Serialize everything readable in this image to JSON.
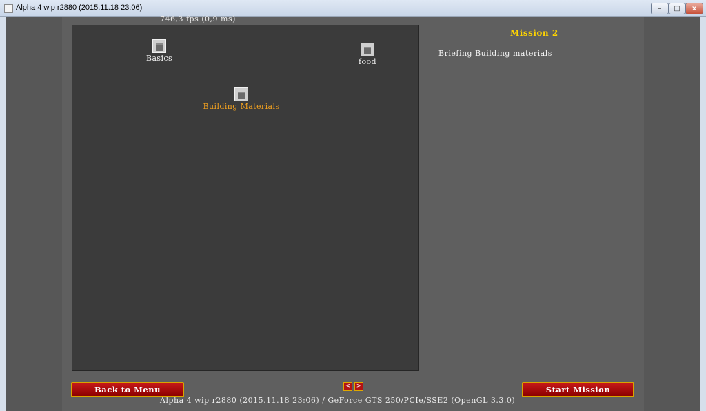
{
  "window": {
    "title": "Alpha 4 wip r2880 (2015.11.18 23:06)",
    "minimize_glyph": "–",
    "maximize_glyph": "□",
    "close_glyph": "x"
  },
  "fps_counter": "746,3 fps (0,9 ms)",
  "campaign_map": {
    "nodes": [
      {
        "label": "Basics",
        "icon": "castle-icon"
      },
      {
        "label": "food",
        "icon": "castle-icon"
      },
      {
        "label": "Building Materials",
        "icon": "castle-icon",
        "selected": true
      }
    ]
  },
  "mission": {
    "title": "Mission 2",
    "briefing": "Briefing Building materials"
  },
  "controls": {
    "back_label": "Back to Menu",
    "start_label": "Start Mission",
    "prev_glyph": "<",
    "next_glyph": ">"
  },
  "footer": "Alpha 4 wip r2880 (2015.11.18 23:06) / GeForce GTS 250/PCIe/SSE2 (OpenGL 3.3.0)",
  "colors": {
    "selected_label": "#f0a020",
    "mission_title": "#ffd400",
    "button_red": "#b31212",
    "button_border": "#d9a400"
  }
}
